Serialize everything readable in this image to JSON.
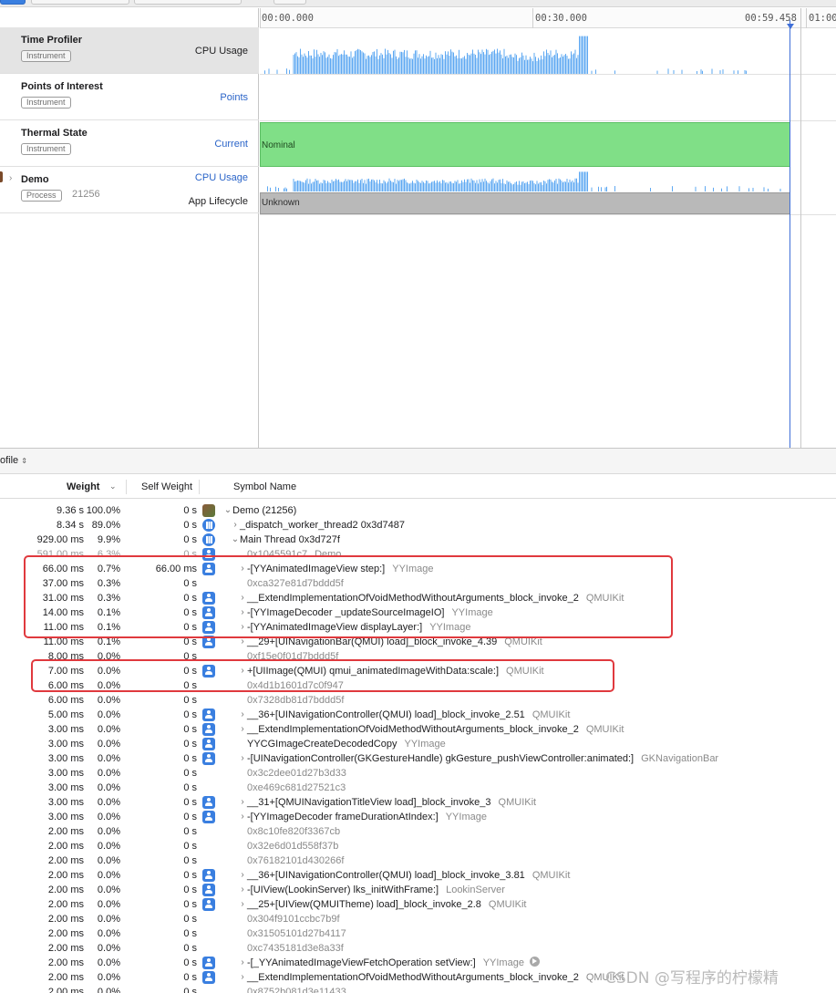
{
  "timeline": {
    "ticks": [
      "00:00.000",
      "00:30.000",
      "00:59.458",
      "01:00"
    ]
  },
  "instruments": [
    {
      "name": "Time Profiler",
      "tag": "Instrument",
      "track": "CPU Usage",
      "selected": true
    },
    {
      "name": "Points of Interest",
      "tag": "Instrument",
      "track": "Points"
    },
    {
      "name": "Thermal State",
      "tag": "Instrument",
      "track": "Current",
      "bar_label": "Nominal",
      "bar_color": "#80df87"
    },
    {
      "name": "Demo",
      "tag": "Process",
      "pid": "21256",
      "track": "CPU Usage",
      "track2": "App Lifecycle",
      "bar_label": "Unknown"
    }
  ],
  "profile": {
    "selector": "ofile"
  },
  "table": {
    "headers": {
      "weight": "Weight",
      "self_weight": "Self Weight",
      "symbol": "Symbol Name"
    },
    "rows": [
      {
        "w": "9.36 s",
        "p": "100.0%",
        "s": "0 s",
        "icon": "app",
        "disc": "⌄",
        "sym": "Demo (21256)",
        "lib": ""
      },
      {
        "w": "8.34 s",
        "p": "89.0%",
        "s": "0 s",
        "icon": "thread",
        "disc": "›",
        "sym": "_dispatch_worker_thread2  0x3d7487",
        "lib": ""
      },
      {
        "w": "929.00 ms",
        "p": "9.9%",
        "s": "0 s",
        "icon": "thread",
        "disc": "⌄",
        "sym": "Main Thread  0x3d727f",
        "lib": ""
      },
      {
        "w": "591.00 ms",
        "p": "6.3%",
        "s": "0 s",
        "icon": "user",
        "disc": "",
        "sym": "0x1045591c7",
        "lib": "Demo",
        "addr": true,
        "faded": true
      },
      {
        "w": "66.00 ms",
        "p": "0.7%",
        "s": "66.00 ms",
        "icon": "user",
        "disc": "›",
        "sym": "-[YYAnimatedImageView step:]",
        "lib": "YYImage"
      },
      {
        "w": "37.00 ms",
        "p": "0.3%",
        "s": "0 s",
        "icon": "",
        "disc": "",
        "sym": "0xca327e81d7bddd5f",
        "lib": "",
        "addr": true
      },
      {
        "w": "31.00 ms",
        "p": "0.3%",
        "s": "0 s",
        "icon": "user",
        "disc": "›",
        "sym": "__ExtendImplementationOfVoidMethodWithoutArguments_block_invoke_2",
        "lib": "QMUIKit"
      },
      {
        "w": "14.00 ms",
        "p": "0.1%",
        "s": "0 s",
        "icon": "user",
        "disc": "›",
        "sym": "-[YYImageDecoder _updateSourceImageIO]",
        "lib": "YYImage"
      },
      {
        "w": "11.00 ms",
        "p": "0.1%",
        "s": "0 s",
        "icon": "user",
        "disc": "›",
        "sym": "-[YYAnimatedImageView displayLayer:]",
        "lib": "YYImage"
      },
      {
        "w": "11.00 ms",
        "p": "0.1%",
        "s": "0 s",
        "icon": "user",
        "disc": "›",
        "sym": "__29+[UINavigationBar(QMUI) load]_block_invoke_4.39",
        "lib": "QMUIKit"
      },
      {
        "w": "8.00 ms",
        "p": "0.0%",
        "s": "0 s",
        "icon": "",
        "disc": "",
        "sym": "0xf15e0f01d7bddd5f",
        "lib": "",
        "addr": true
      },
      {
        "w": "7.00 ms",
        "p": "0.0%",
        "s": "0 s",
        "icon": "user",
        "disc": "›",
        "sym": "+[UIImage(QMUI) qmui_animatedImageWithData:scale:]",
        "lib": "QMUIKit"
      },
      {
        "w": "6.00 ms",
        "p": "0.0%",
        "s": "0 s",
        "icon": "",
        "disc": "",
        "sym": "0x4d1b1601d7c0f947",
        "lib": "",
        "addr": true
      },
      {
        "w": "6.00 ms",
        "p": "0.0%",
        "s": "0 s",
        "icon": "",
        "disc": "",
        "sym": "0x7328db81d7bddd5f",
        "lib": "",
        "addr": true
      },
      {
        "w": "5.00 ms",
        "p": "0.0%",
        "s": "0 s",
        "icon": "user",
        "disc": "›",
        "sym": "__36+[UINavigationController(QMUI) load]_block_invoke_2.51",
        "lib": "QMUIKit"
      },
      {
        "w": "3.00 ms",
        "p": "0.0%",
        "s": "0 s",
        "icon": "user",
        "disc": "›",
        "sym": "__ExtendImplementationOfVoidMethodWithoutArguments_block_invoke_2",
        "lib": "QMUIKit"
      },
      {
        "w": "3.00 ms",
        "p": "0.0%",
        "s": "0 s",
        "icon": "user",
        "disc": "",
        "sym": "YYCGImageCreateDecodedCopy",
        "lib": "YYImage"
      },
      {
        "w": "3.00 ms",
        "p": "0.0%",
        "s": "0 s",
        "icon": "user",
        "disc": "›",
        "sym": "-[UINavigationController(GKGestureHandle) gkGesture_pushViewController:animated:]",
        "lib": "GKNavigationBar"
      },
      {
        "w": "3.00 ms",
        "p": "0.0%",
        "s": "0 s",
        "icon": "",
        "disc": "",
        "sym": "0x3c2dee01d27b3d33",
        "lib": "",
        "addr": true
      },
      {
        "w": "3.00 ms",
        "p": "0.0%",
        "s": "0 s",
        "icon": "",
        "disc": "",
        "sym": "0xe469c681d27521c3",
        "lib": "",
        "addr": true
      },
      {
        "w": "3.00 ms",
        "p": "0.0%",
        "s": "0 s",
        "icon": "user",
        "disc": "›",
        "sym": "__31+[QMUINavigationTitleView load]_block_invoke_3",
        "lib": "QMUIKit"
      },
      {
        "w": "3.00 ms",
        "p": "0.0%",
        "s": "0 s",
        "icon": "user",
        "disc": "›",
        "sym": "-[YYImageDecoder frameDurationAtIndex:]",
        "lib": "YYImage"
      },
      {
        "w": "2.00 ms",
        "p": "0.0%",
        "s": "0 s",
        "icon": "",
        "disc": "",
        "sym": "0x8c10fe820f3367cb",
        "lib": "",
        "addr": true
      },
      {
        "w": "2.00 ms",
        "p": "0.0%",
        "s": "0 s",
        "icon": "",
        "disc": "",
        "sym": "0x32e6d01d558f37b",
        "lib": "",
        "addr": true
      },
      {
        "w": "2.00 ms",
        "p": "0.0%",
        "s": "0 s",
        "icon": "",
        "disc": "",
        "sym": "0x76182101d430266f",
        "lib": "",
        "addr": true
      },
      {
        "w": "2.00 ms",
        "p": "0.0%",
        "s": "0 s",
        "icon": "user",
        "disc": "›",
        "sym": "__36+[UINavigationController(QMUI) load]_block_invoke_3.81",
        "lib": "QMUIKit"
      },
      {
        "w": "2.00 ms",
        "p": "0.0%",
        "s": "0 s",
        "icon": "user",
        "disc": "›",
        "sym": "-[UIView(LookinServer) lks_initWithFrame:]",
        "lib": "LookinServer"
      },
      {
        "w": "2.00 ms",
        "p": "0.0%",
        "s": "0 s",
        "icon": "user",
        "disc": "›",
        "sym": "__25+[UIView(QMUITheme) load]_block_invoke_2.8",
        "lib": "QMUIKit"
      },
      {
        "w": "2.00 ms",
        "p": "0.0%",
        "s": "0 s",
        "icon": "",
        "disc": "",
        "sym": "0x304f9101ccbc7b9f",
        "lib": "",
        "addr": true
      },
      {
        "w": "2.00 ms",
        "p": "0.0%",
        "s": "0 s",
        "icon": "",
        "disc": "",
        "sym": "0x31505101d27b4117",
        "lib": "",
        "addr": true
      },
      {
        "w": "2.00 ms",
        "p": "0.0%",
        "s": "0 s",
        "icon": "",
        "disc": "",
        "sym": "0xc7435181d3e8a33f",
        "lib": "",
        "addr": true
      },
      {
        "w": "2.00 ms",
        "p": "0.0%",
        "s": "0 s",
        "icon": "user",
        "disc": "›",
        "sym": "-[_YYAnimatedImageViewFetchOperation setView:]",
        "lib": "YYImage",
        "go": true
      },
      {
        "w": "2.00 ms",
        "p": "0.0%",
        "s": "0 s",
        "icon": "user",
        "disc": "›",
        "sym": "__ExtendImplementationOfVoidMethodWithoutArguments_block_invoke_2",
        "lib": "QMUIKit"
      },
      {
        "w": "2.00 ms",
        "p": "0.0%",
        "s": "0 s",
        "icon": "",
        "disc": "",
        "sym": "0x8752b081d3e11433",
        "lib": "",
        "addr": true
      }
    ]
  },
  "annotation_color": "#e0393e",
  "watermark": "CSDN @写程序的柠檬精"
}
